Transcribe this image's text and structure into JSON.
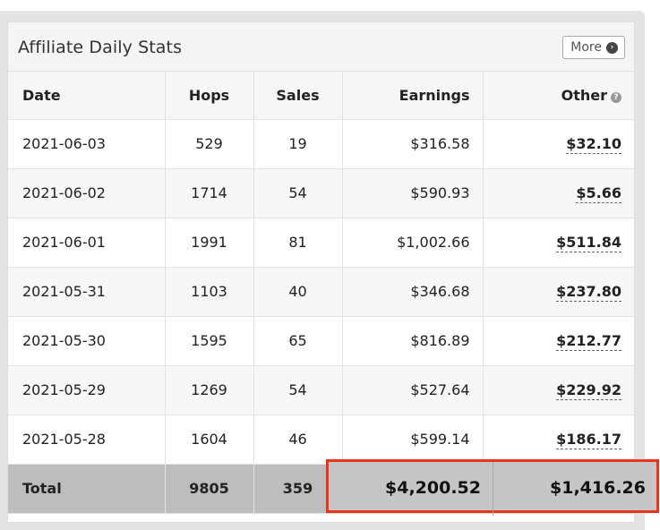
{
  "panel": {
    "title": "Affiliate Daily Stats",
    "more_label": "More"
  },
  "table": {
    "headers": {
      "date": "Date",
      "hops": "Hops",
      "sales": "Sales",
      "earnings": "Earnings",
      "other": "Other"
    },
    "rows": [
      {
        "date": "2021-06-03",
        "hops": "529",
        "sales": "19",
        "earnings": "$316.58",
        "other": "$32.10"
      },
      {
        "date": "2021-06-02",
        "hops": "1714",
        "sales": "54",
        "earnings": "$590.93",
        "other": "$5.66"
      },
      {
        "date": "2021-06-01",
        "hops": "1991",
        "sales": "81",
        "earnings": "$1,002.66",
        "other": "$511.84"
      },
      {
        "date": "2021-05-31",
        "hops": "1103",
        "sales": "40",
        "earnings": "$346.68",
        "other": "$237.80"
      },
      {
        "date": "2021-05-30",
        "hops": "1595",
        "sales": "65",
        "earnings": "$816.89",
        "other": "$212.77"
      },
      {
        "date": "2021-05-29",
        "hops": "1269",
        "sales": "54",
        "earnings": "$527.64",
        "other": "$229.92"
      },
      {
        "date": "2021-05-28",
        "hops": "1604",
        "sales": "46",
        "earnings": "$599.14",
        "other": "$186.17"
      }
    ],
    "total": {
      "label": "Total",
      "hops": "9805",
      "sales": "359",
      "earnings": "$4,200.52",
      "other": "$1,416.26"
    }
  },
  "colors": {
    "highlight_border": "#e8351b",
    "total_row_bg": "#bdbdbd"
  },
  "icons": {
    "more": "chevron-circle-right-icon",
    "help": "question-circle-icon"
  }
}
